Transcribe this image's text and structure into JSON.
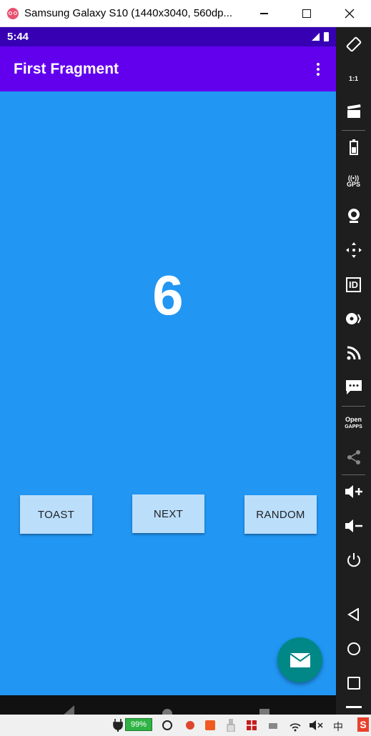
{
  "window": {
    "title": "Samsung Galaxy S10 (1440x3040, 560dp..."
  },
  "status_bar": {
    "time": "5:44"
  },
  "app_bar": {
    "title": "First Fragment"
  },
  "main": {
    "counter_value": "6",
    "buttons": {
      "toast": "TOAST",
      "next": "NEXT",
      "random": "RANDOM"
    }
  },
  "sidebar": {
    "open_gapps_label_1": "Open",
    "open_gapps_label_2": "GAPPS",
    "id_label": "ID",
    "gps_label": "GPS",
    "ratio_label": "1:1"
  },
  "taskbar": {
    "battery_percent": "99%",
    "ime_label": "中",
    "brand_label": "S"
  },
  "colors": {
    "status_bar": "#3700b3",
    "app_bar": "#6200ee",
    "background": "#2196f3",
    "button": "#bbdefb",
    "fab": "#018786"
  }
}
